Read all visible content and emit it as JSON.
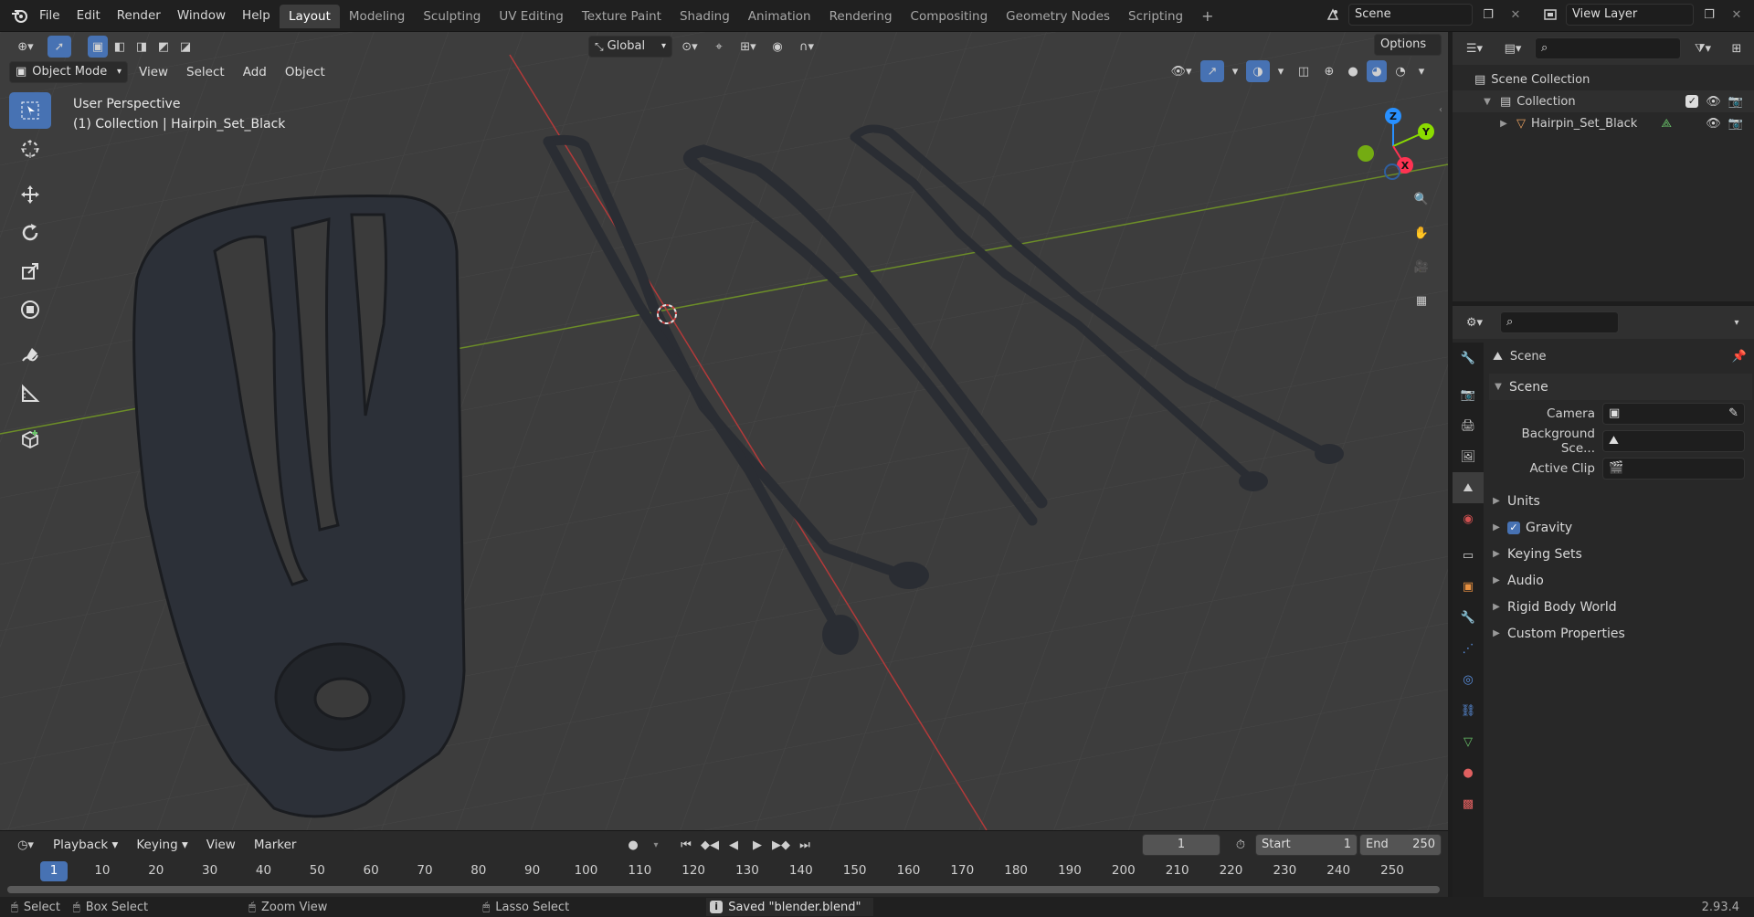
{
  "topbar": {
    "menus": [
      "File",
      "Edit",
      "Render",
      "Window",
      "Help"
    ],
    "workspaces": [
      "Layout",
      "Modeling",
      "Sculpting",
      "UV Editing",
      "Texture Paint",
      "Shading",
      "Animation",
      "Rendering",
      "Compositing",
      "Geometry Nodes",
      "Scripting"
    ],
    "active_workspace": "Layout",
    "add_tab": "+",
    "scene": "Scene",
    "view_layer": "View Layer"
  },
  "viewport_header": {
    "transform_orientation": "Global",
    "options": "Options",
    "mode": "Object Mode",
    "menus": [
      "View",
      "Select",
      "Add",
      "Object"
    ]
  },
  "overlay": {
    "line1": "User Perspective",
    "line2": "(1) Collection | Hairpin_Set_Black"
  },
  "gizmo": {
    "z": "Z",
    "y": "Y",
    "x": "X"
  },
  "outliner": {
    "search_placeholder": "",
    "root": "Scene Collection",
    "collection": "Collection",
    "object": "Hairpin_Set_Black"
  },
  "properties": {
    "search_placeholder": "",
    "context": "Scene",
    "panel_title": "Scene",
    "camera_label": "Camera",
    "background_label": "Background Sce...",
    "active_clip_label": "Active Clip",
    "sections": [
      "Units",
      "Gravity",
      "Keying Sets",
      "Audio",
      "Rigid Body World",
      "Custom Properties"
    ],
    "gravity_checked": true
  },
  "timeline": {
    "menus": [
      "Playback",
      "Keying",
      "View",
      "Marker"
    ],
    "current_frame": "1",
    "start_label": "Start",
    "start": "1",
    "end_label": "End",
    "end": "250",
    "ticks": [
      "1",
      "10",
      "20",
      "30",
      "40",
      "50",
      "60",
      "70",
      "80",
      "90",
      "100",
      "110",
      "120",
      "130",
      "140",
      "150",
      "160",
      "170",
      "180",
      "190",
      "200",
      "210",
      "220",
      "230",
      "240",
      "250"
    ]
  },
  "statusbar": {
    "select": "Select",
    "box_select": "Box Select",
    "zoom_view": "Zoom View",
    "lasso_select": "Lasso Select",
    "message": "Saved \"blender.blend\"",
    "version": "2.93.4"
  },
  "colors": {
    "accent": "#4772b3",
    "x_axis": "#ff3352",
    "y_axis": "#8bdc00",
    "z_axis": "#2890ff"
  }
}
